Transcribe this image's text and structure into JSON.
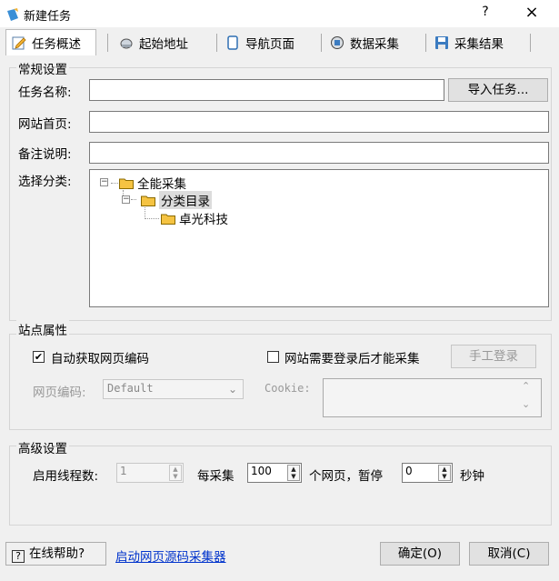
{
  "window": {
    "title": "新建任务",
    "help": "?",
    "close": "×"
  },
  "tabs": [
    {
      "label": "任务概述",
      "icon": "edit-icon",
      "active": true
    },
    {
      "label": "起始地址",
      "icon": "disk-icon"
    },
    {
      "label": "导航页面",
      "icon": "page-icon"
    },
    {
      "label": "数据采集",
      "icon": "database-icon"
    },
    {
      "label": "采集结果",
      "icon": "save-icon"
    }
  ],
  "general": {
    "legend": "常规设置",
    "task_name_label": "任务名称:",
    "task_name_value": "",
    "import_button": "导入任务...",
    "homepage_label": "网站首页:",
    "homepage_value": "",
    "note_label": "备注说明:",
    "note_value": "",
    "category_label": "选择分类:",
    "tree": [
      {
        "label": "全能采集",
        "level": 0,
        "expander": "−"
      },
      {
        "label": "分类目录",
        "level": 1,
        "expander": "−",
        "selected": true
      },
      {
        "label": "卓光科技",
        "level": 2
      }
    ]
  },
  "site": {
    "legend": "站点属性",
    "auto_encoding_label": "自动获取网页编码",
    "auto_encoding_checked": true,
    "login_required_label": "网站需要登录后才能采集",
    "login_required_checked": false,
    "manual_login_button": "手工登录",
    "encoding_label": "网页编码:",
    "encoding_value": "Default",
    "cookie_label": "Cookie:",
    "cookie_value": ""
  },
  "advanced": {
    "legend": "高级设置",
    "threads_label": "启用线程数:",
    "threads_value": "1",
    "per_collect_label": "每采集",
    "per_collect_value": "100",
    "pages_pause_label": "个网页，暂停",
    "pause_value": "0",
    "seconds_label": "秒钟"
  },
  "footer": {
    "help_icon": "question-icon",
    "help_label": "在线帮助?",
    "source_link": "启动网页源码采集器",
    "ok_button": "确定(O)",
    "cancel_button": "取消(C)"
  },
  "colors": {
    "accent": "#0033cc",
    "folder": "#f5c342",
    "tab_border": "#bbbbbb"
  }
}
